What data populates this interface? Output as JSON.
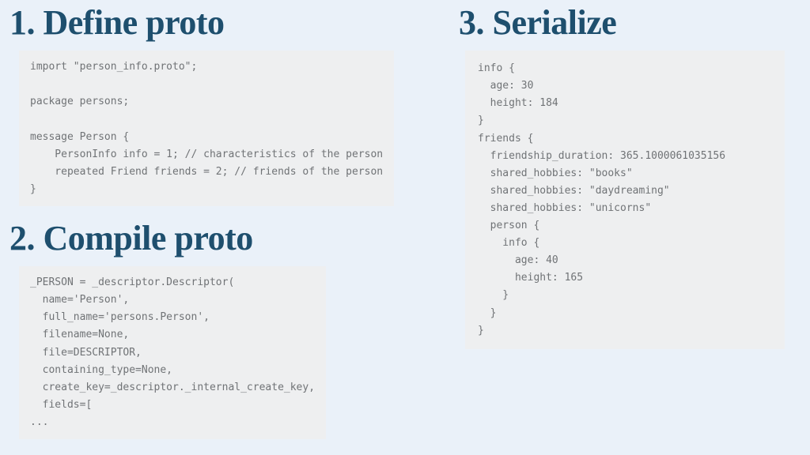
{
  "headings": {
    "step1": "1. Define proto",
    "step2": "2. Compile proto",
    "step3": "3. Serialize"
  },
  "code": {
    "define_proto": "import \"person_info.proto\";\n\npackage persons;\n\nmessage Person {\n    PersonInfo info = 1; // characteristics of the person\n    repeated Friend friends = 2; // friends of the person\n}",
    "compile_proto": "_PERSON = _descriptor.Descriptor(\n  name='Person',\n  full_name='persons.Person',\n  filename=None,\n  file=DESCRIPTOR,\n  containing_type=None,\n  create_key=_descriptor._internal_create_key,\n  fields=[\n...",
    "serialize": "info {\n  age: 30\n  height: 184\n}\nfriends {\n  friendship_duration: 365.1000061035156\n  shared_hobbies: \"books\"\n  shared_hobbies: \"daydreaming\"\n  shared_hobbies: \"unicorns\"\n  person {\n    info {\n      age: 40\n      height: 165\n    }\n  }\n}"
  }
}
